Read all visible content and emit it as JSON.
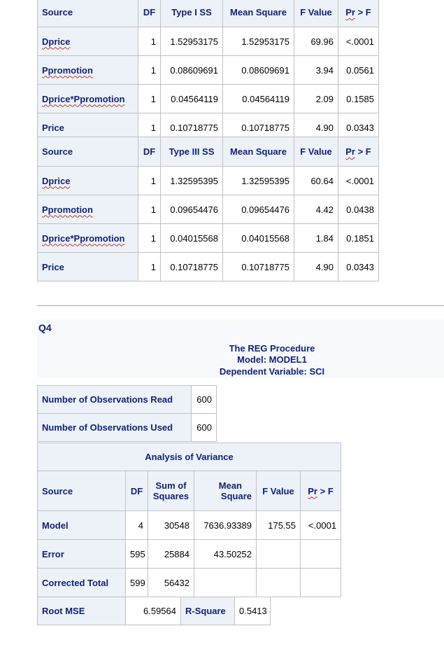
{
  "type1_table": {
    "headers": [
      "Source",
      "DF",
      "Type I SS",
      "Mean Square",
      "F Value",
      "Pr > F"
    ],
    "rows": [
      {
        "source": "Dprice",
        "df": "1",
        "ss": "1.52953175",
        "ms": "1.52953175",
        "f": "69.96",
        "p": "<.0001"
      },
      {
        "source": "Ppromotion",
        "df": "1",
        "ss": "0.08609691",
        "ms": "0.08609691",
        "f": "3.94",
        "p": "0.0561"
      },
      {
        "source": "Dprice*Ppromotion",
        "df": "1",
        "ss": "0.04564119",
        "ms": "0.04564119",
        "f": "2.09",
        "p": "0.1585"
      },
      {
        "source": "Price",
        "df": "1",
        "ss": "0.10718775",
        "ms": "0.10718775",
        "f": "4.90",
        "p": "0.0343"
      }
    ]
  },
  "type3_table": {
    "headers": [
      "Source",
      "DF",
      "Type III SS",
      "Mean Square",
      "F Value",
      "Pr > F"
    ],
    "rows": [
      {
        "source": "Dprice",
        "df": "1",
        "ss": "1.32595395",
        "ms": "1.32595395",
        "f": "60.64",
        "p": "<.0001"
      },
      {
        "source": "Ppromotion",
        "df": "1",
        "ss": "0.09654476",
        "ms": "0.09654476",
        "f": "4.42",
        "p": "0.0438"
      },
      {
        "source": "Dprice*Ppromotion",
        "df": "1",
        "ss": "0.04015568",
        "ms": "0.04015568",
        "f": "1.84",
        "p": "0.1851"
      },
      {
        "source": "Price",
        "df": "1",
        "ss": "0.10718775",
        "ms": "0.10718775",
        "f": "4.90",
        "p": "0.0343"
      }
    ]
  },
  "q4": {
    "heading": "Q4",
    "proc_title": "The REG Procedure",
    "model": "Model: MODEL1",
    "dependent": "Dependent Variable: SCI"
  },
  "obs_table": {
    "rows": [
      {
        "label": "Number of Observations Read",
        "value": "600"
      },
      {
        "label": "Number of Observations Used",
        "value": "600"
      }
    ]
  },
  "anova_table": {
    "title": "Analysis of Variance",
    "headers": {
      "source": "Source",
      "df": "DF",
      "ss_1": "Sum of",
      "ss_2": "Squares",
      "ms_1": "Mean",
      "ms_2": "Square",
      "f": "F Value",
      "p": "Pr > F"
    },
    "rows": [
      {
        "source": "Model",
        "df": "4",
        "ss": "30548",
        "ms": "7636.93389",
        "f": "175.55",
        "p": "<.0001"
      },
      {
        "source": "Error",
        "df": "595",
        "ss": "25884",
        "ms": "43.50252",
        "f": "",
        "p": ""
      },
      {
        "source": "Corrected Total",
        "df": "599",
        "ss": "56432",
        "ms": "",
        "f": "",
        "p": ""
      }
    ]
  },
  "fit_table": {
    "root_mse_label": "Root MSE",
    "root_mse": "6.59564",
    "rsq_label": "R-Square",
    "rsq": "0.5413"
  }
}
